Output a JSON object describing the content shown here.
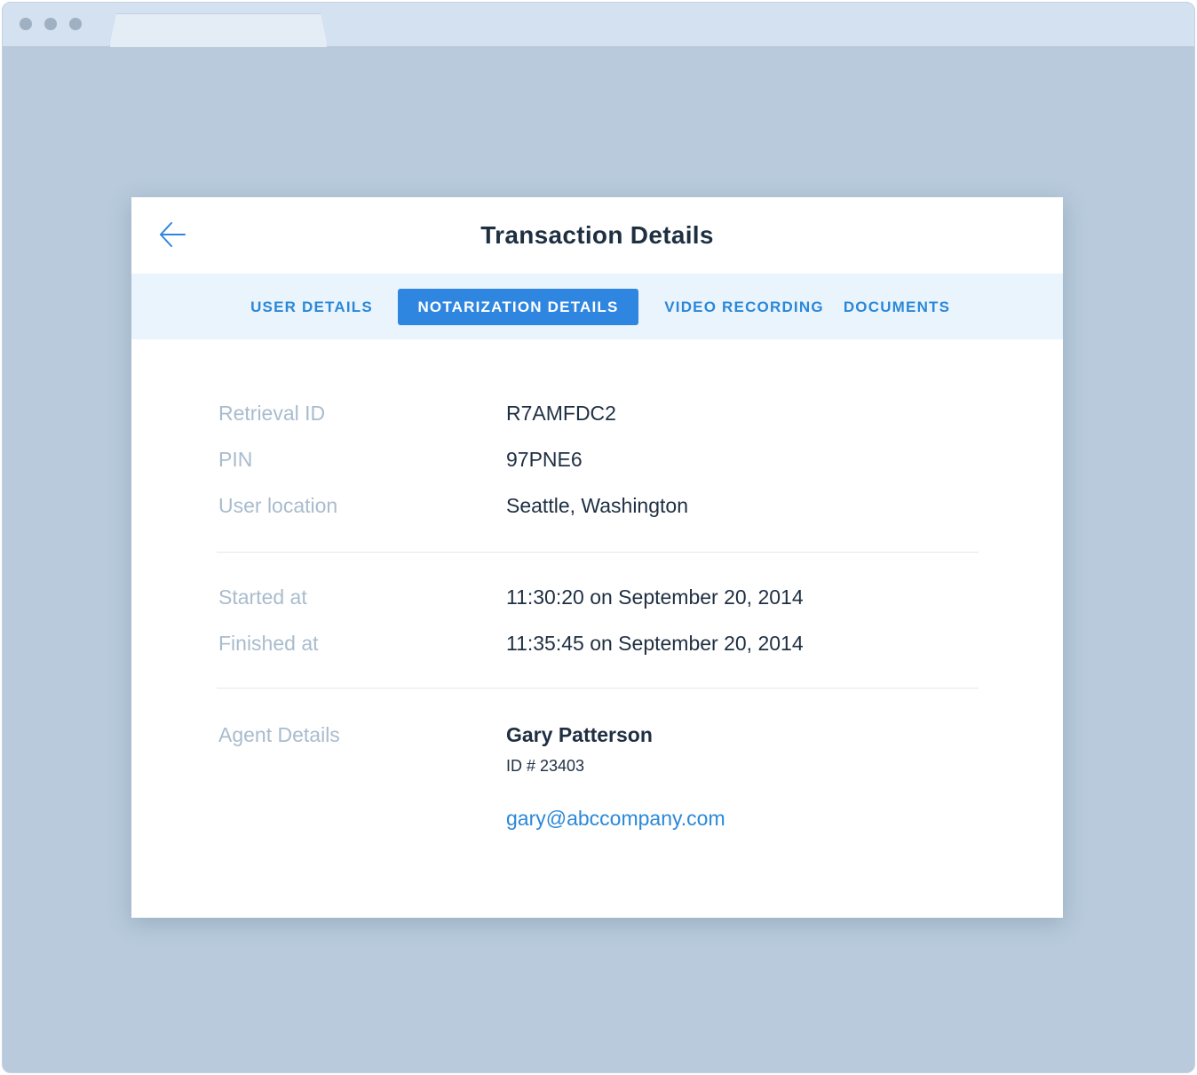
{
  "card": {
    "title": "Transaction Details"
  },
  "tabs": [
    {
      "label": "USER DETAILS",
      "active": false
    },
    {
      "label": "NOTARIZATION DETAILS",
      "active": true
    },
    {
      "label": "VIDEO RECORDING",
      "active": false
    },
    {
      "label": "DOCUMENTS",
      "active": false
    }
  ],
  "details": {
    "retrieval_id": {
      "label": "Retrieval ID",
      "value": "R7AMFDC2"
    },
    "pin": {
      "label": "PIN",
      "value": "97PNE6"
    },
    "user_location": {
      "label": "User location",
      "value": "Seattle, Washington"
    },
    "started_at": {
      "label": "Started at",
      "value": "11:30:20 on September 20, 2014"
    },
    "finished_at": {
      "label": "Finished at",
      "value": "11:35:45 on September 20, 2014"
    },
    "agent": {
      "label": "Agent Details",
      "name": "Gary Patterson",
      "id": "ID # 23403",
      "email": "gary@abccompany.com"
    }
  },
  "icons": {
    "back": "arrow-left-icon"
  },
  "colors": {
    "accent": "#2f86e0",
    "link": "#2b88d8",
    "tabbar_bg": "#eaf4fd",
    "label": "#a9bccd",
    "text": "#1f2f42",
    "page_bg": "#b8cadb"
  }
}
